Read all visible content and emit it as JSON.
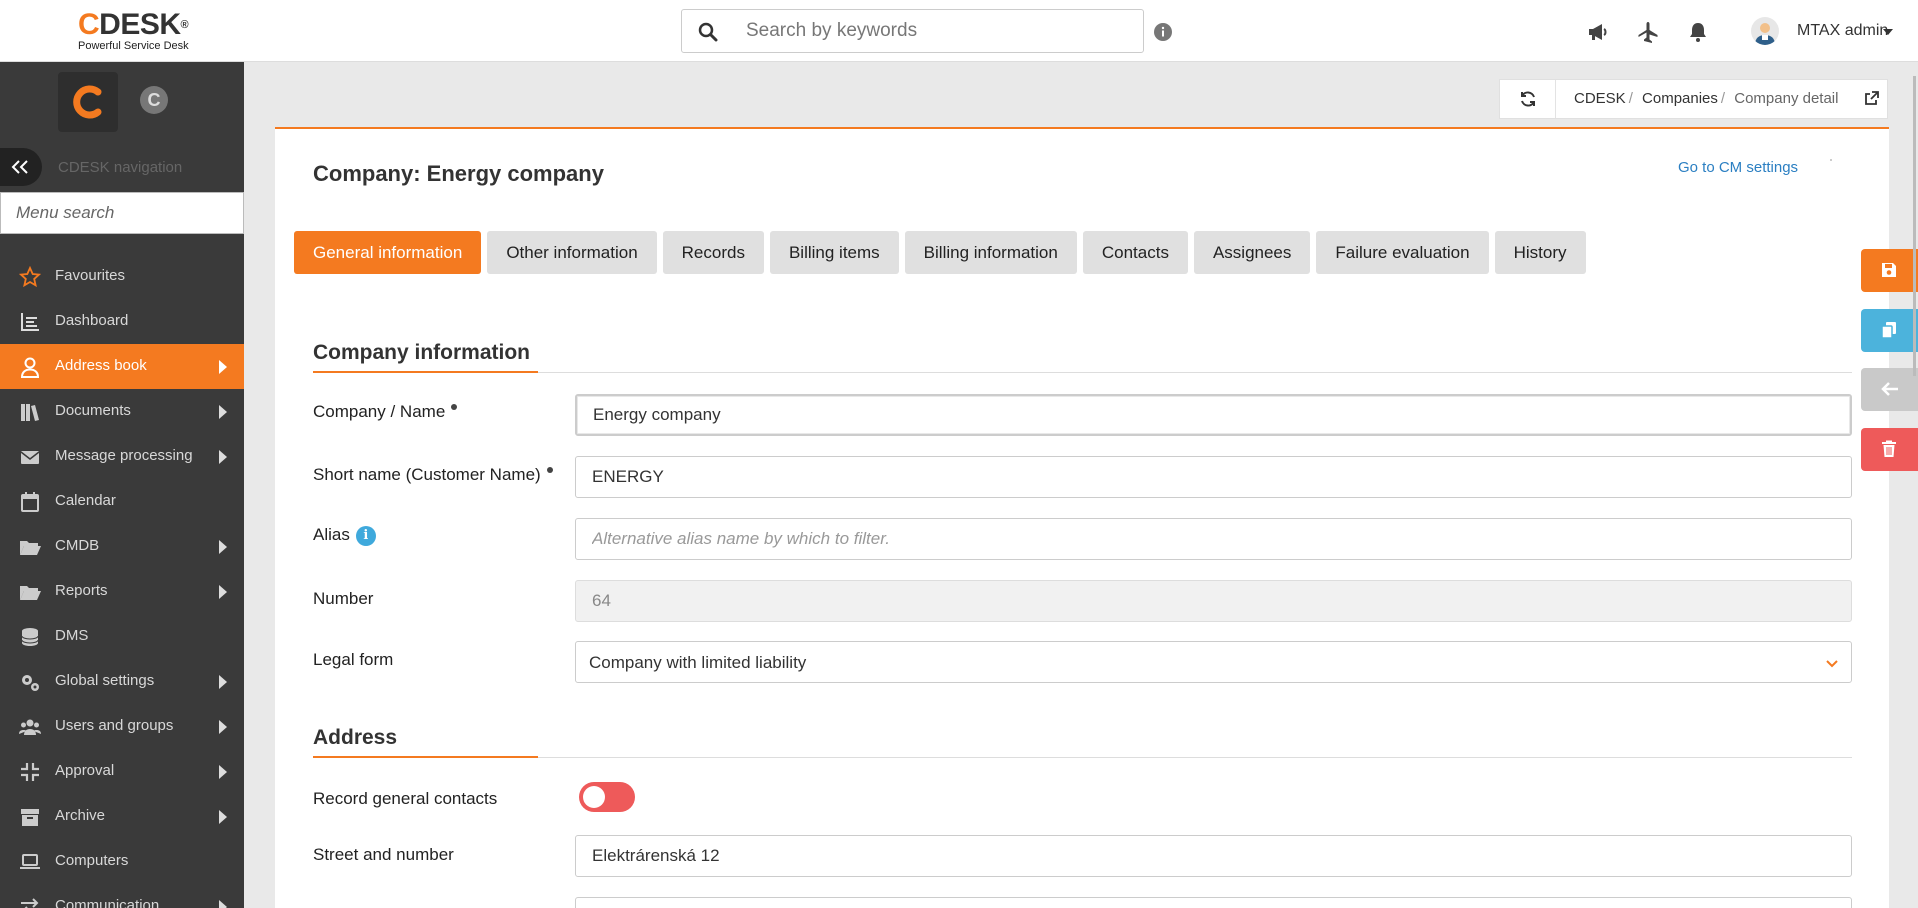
{
  "header": {
    "logo_word": "DESK",
    "logo_letter": "C",
    "logo_reg": "®",
    "logo_tagline": "Powerful Service Desk",
    "search_placeholder": "Search by keywords",
    "username": "MTAX admin"
  },
  "sidebar": {
    "nav_title": "CDESK navigation",
    "small_logo_letter": "C",
    "menu_search_placeholder": "Menu search",
    "items": [
      {
        "label": "Favourites",
        "icon": "star-icon",
        "arrow": false,
        "active": false
      },
      {
        "label": "Dashboard",
        "icon": "chart-icon",
        "arrow": false,
        "active": false
      },
      {
        "label": "Address book",
        "icon": "user-icon",
        "arrow": true,
        "active": true
      },
      {
        "label": "Documents",
        "icon": "books-icon",
        "arrow": true,
        "active": false
      },
      {
        "label": "Message processing",
        "icon": "envelope-icon",
        "arrow": true,
        "active": false
      },
      {
        "label": "Calendar",
        "icon": "calendar-icon",
        "arrow": false,
        "active": false
      },
      {
        "label": "CMDB",
        "icon": "folder-open-icon",
        "arrow": true,
        "active": false
      },
      {
        "label": "Reports",
        "icon": "folder-open-icon",
        "arrow": true,
        "active": false
      },
      {
        "label": "DMS",
        "icon": "database-icon",
        "arrow": false,
        "active": false
      },
      {
        "label": "Global settings",
        "icon": "gears-icon",
        "arrow": true,
        "active": false
      },
      {
        "label": "Users and groups",
        "icon": "users-icon",
        "arrow": true,
        "active": false
      },
      {
        "label": "Approval",
        "icon": "compress-icon",
        "arrow": true,
        "active": false
      },
      {
        "label": "Archive",
        "icon": "archive-icon",
        "arrow": true,
        "active": false
      },
      {
        "label": "Computers",
        "icon": "laptop-icon",
        "arrow": false,
        "active": false
      },
      {
        "label": "Communication",
        "icon": "exchange-icon",
        "arrow": true,
        "active": false
      }
    ]
  },
  "breadcrumb": {
    "items": [
      "CDESK",
      "Companies"
    ],
    "current": "Company detail",
    "separator": "/"
  },
  "page": {
    "title": "Company: Energy company",
    "cm_link": "Go to CM settings"
  },
  "tabs": [
    {
      "label": "General information",
      "active": true
    },
    {
      "label": "Other information",
      "active": false
    },
    {
      "label": "Records",
      "active": false
    },
    {
      "label": "Billing items",
      "active": false
    },
    {
      "label": "Billing information",
      "active": false
    },
    {
      "label": "Contacts",
      "active": false
    },
    {
      "label": "Assignees",
      "active": false
    },
    {
      "label": "Failure evaluation",
      "active": false
    },
    {
      "label": "History",
      "active": false
    }
  ],
  "company_info": {
    "section_title": "Company information",
    "name_label": "Company / Name",
    "name_value": "Energy company",
    "short_label": "Short name (Customer Name)",
    "short_value": "ENERGY",
    "alias_label": "Alias",
    "alias_info": "i",
    "alias_placeholder": "Alternative alias name by which to filter.",
    "number_label": "Number",
    "number_value": "64",
    "legal_label": "Legal form",
    "legal_value": "Company with limited liability"
  },
  "address": {
    "section_title": "Address",
    "record_contacts_label": "Record general contacts",
    "record_contacts_on": false,
    "street_label": "Street and number",
    "street_value": "Elektrárenská 12"
  },
  "colors": {
    "accent": "#f47a20",
    "sidebar_bg": "#3a3a3a",
    "link": "#2b7fc2",
    "copy_button": "#4cb3dc",
    "delete_button": "#ee5a5a"
  }
}
